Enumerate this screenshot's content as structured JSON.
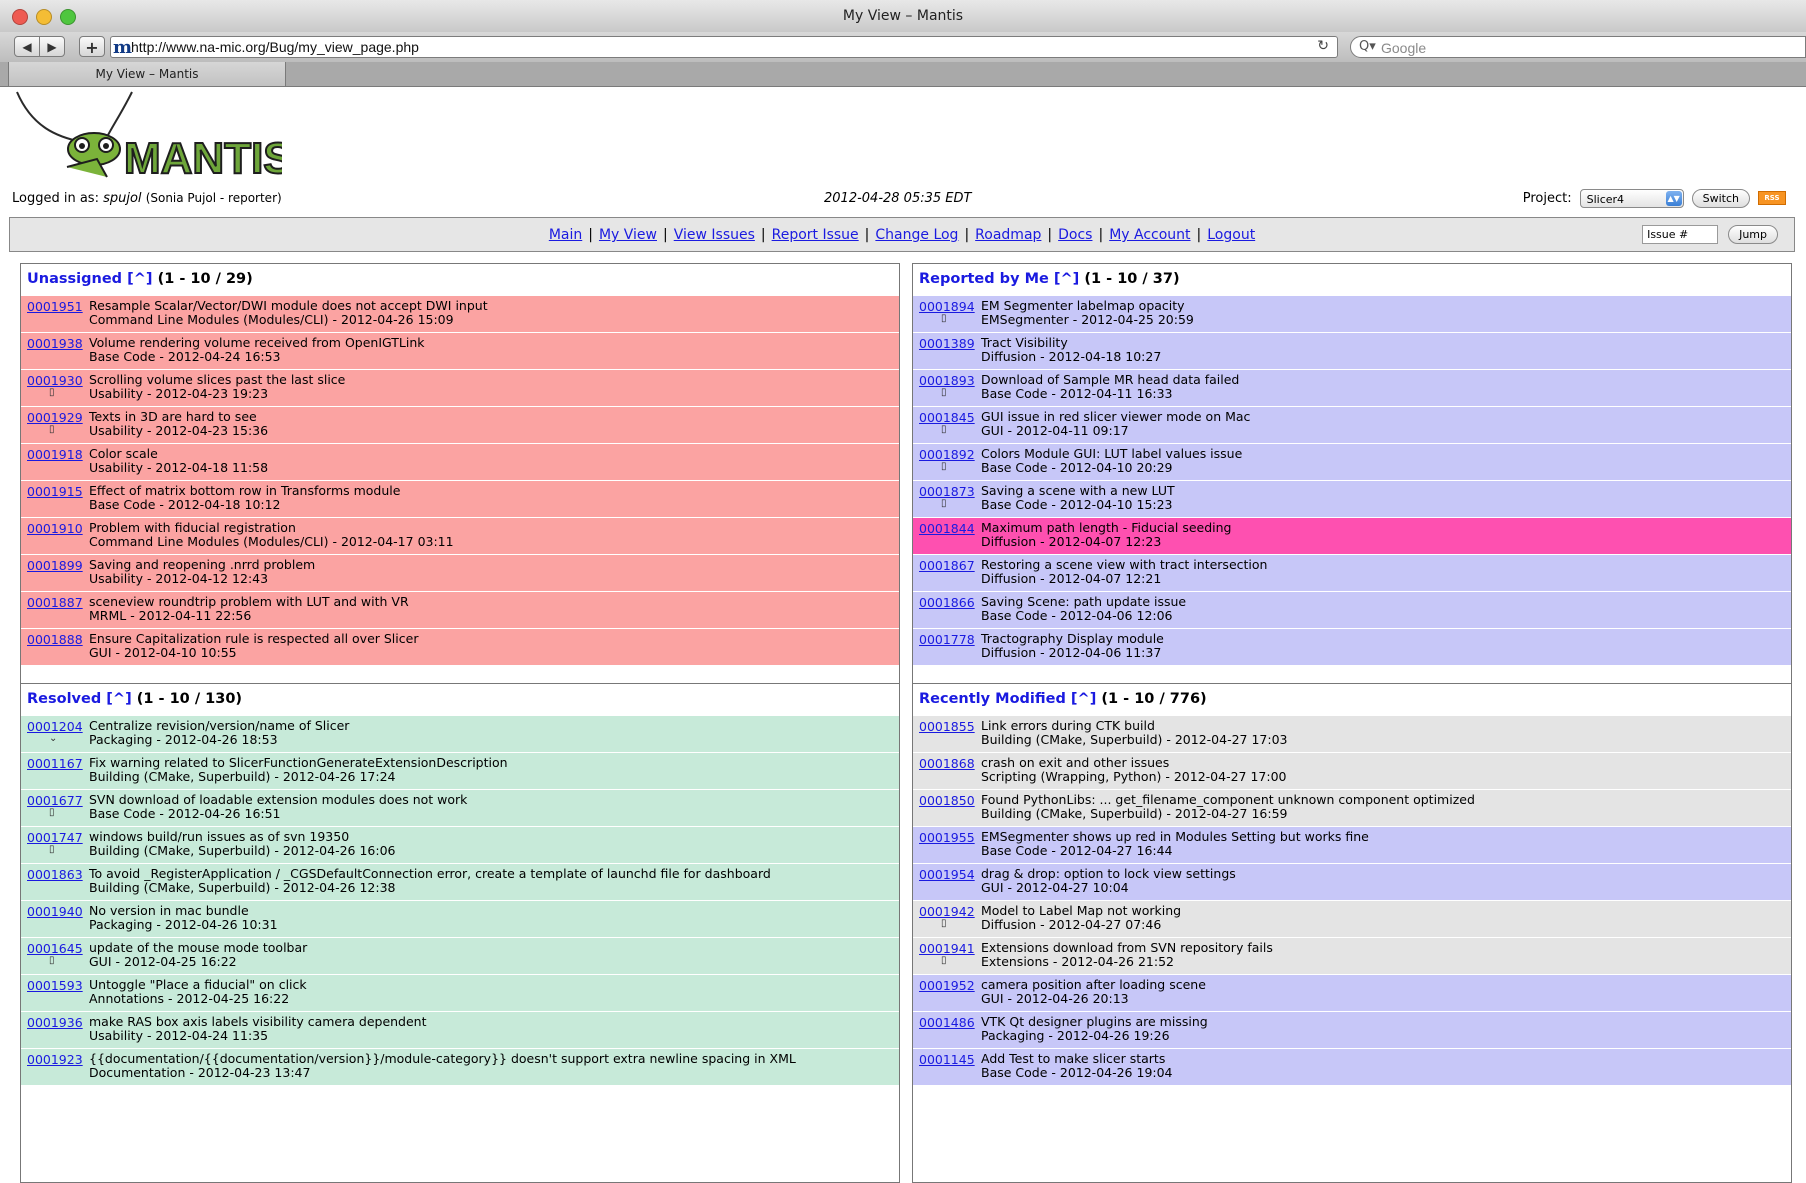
{
  "browser": {
    "window_title": "My View – Mantis",
    "url": "http://www.na-mic.org/Bug/my_view_page.php",
    "search_placeholder": "Google",
    "tab_label": "My View – Mantis",
    "favicon": "m"
  },
  "header": {
    "logo_text": "MANTIS",
    "logged_in_label": "Logged in as: ",
    "username": "spujol",
    "role": "(Sonia Pujol - reporter)",
    "datetime": "2012-04-28 05:35 EDT",
    "project_label": "Project:",
    "project_value": "Slicer4",
    "switch_label": "Switch",
    "rss_label": "RSS"
  },
  "menu": {
    "items": [
      {
        "label": "Main"
      },
      {
        "label": "My View"
      },
      {
        "label": "View Issues"
      },
      {
        "label": "Report Issue"
      },
      {
        "label": "Change Log"
      },
      {
        "label": "Roadmap"
      },
      {
        "label": "Docs"
      },
      {
        "label": "My Account"
      },
      {
        "label": "Logout"
      }
    ],
    "issue_placeholder": "Issue #",
    "jump_label": "Jump"
  },
  "boxes": {
    "unassigned": {
      "title": "Unassigned",
      "caret": "[^]",
      "range": "(1 - 10 / 29)",
      "rows": [
        {
          "id": "0001951",
          "title": "Resample Scalar/Vector/DWI module does not accept DWI input",
          "meta": "Command Line Modules (Modules/CLI) - 2012-04-26 15:09",
          "attachment": false,
          "color": "red"
        },
        {
          "id": "0001938",
          "title": "Volume rendering volume received from OpenIGTLink",
          "meta": "Base Code - 2012-04-24 16:53",
          "attachment": false,
          "color": "red"
        },
        {
          "id": "0001930",
          "title": "Scrolling volume slices past the last slice",
          "meta": "Usability - 2012-04-23 19:23",
          "attachment": true,
          "color": "red"
        },
        {
          "id": "0001929",
          "title": "Texts in 3D are hard to see",
          "meta": "Usability - 2012-04-23 15:36",
          "attachment": true,
          "color": "red"
        },
        {
          "id": "0001918",
          "title": "Color scale",
          "meta": "Usability - 2012-04-18 11:58",
          "attachment": false,
          "color": "red"
        },
        {
          "id": "0001915",
          "title": "Effect of matrix bottom row in Transforms module",
          "meta": "Base Code - 2012-04-18 10:12",
          "attachment": false,
          "color": "red"
        },
        {
          "id": "0001910",
          "title": "Problem with fiducial registration",
          "meta": "Command Line Modules (Modules/CLI) - 2012-04-17 03:11",
          "attachment": false,
          "color": "red"
        },
        {
          "id": "0001899",
          "title": "Saving and reopening .nrrd problem",
          "meta": "Usability - 2012-04-12 12:43",
          "attachment": false,
          "color": "red"
        },
        {
          "id": "0001887",
          "title": "sceneview roundtrip problem with LUT and with VR",
          "meta": "MRML - 2012-04-11 22:56",
          "attachment": false,
          "color": "red"
        },
        {
          "id": "0001888",
          "title": "Ensure Capitalization rule is respected all over Slicer",
          "meta": "GUI - 2012-04-10 10:55",
          "attachment": false,
          "color": "red"
        }
      ]
    },
    "reported_by_me": {
      "title": "Reported by Me",
      "caret": "[^]",
      "range": "(1 - 10 / 37)",
      "rows": [
        {
          "id": "0001894",
          "title": "EM Segmenter labelmap opacity",
          "meta": "EMSegmenter - 2012-04-25 20:59",
          "attachment": true,
          "color": "blue"
        },
        {
          "id": "0001389",
          "title": "Tract Visibility",
          "meta": "Diffusion - 2012-04-18 10:27",
          "attachment": false,
          "color": "blue"
        },
        {
          "id": "0001893",
          "title": "Download of Sample MR head data failed",
          "meta": "Base Code - 2012-04-11 16:33",
          "attachment": true,
          "color": "blue"
        },
        {
          "id": "0001845",
          "title": "GUI issue in red slicer viewer mode on Mac",
          "meta": "GUI - 2012-04-11 09:17",
          "attachment": true,
          "color": "blue"
        },
        {
          "id": "0001892",
          "title": "Colors Module GUI: LUT label values issue",
          "meta": "Base Code - 2012-04-10 20:29",
          "attachment": true,
          "color": "blue"
        },
        {
          "id": "0001873",
          "title": "Saving a scene with a new LUT",
          "meta": "Base Code - 2012-04-10 15:23",
          "attachment": true,
          "color": "blue"
        },
        {
          "id": "0001844",
          "title": "Maximum path length - Fiducial seeding",
          "meta": "Diffusion - 2012-04-07 12:23",
          "attachment": false,
          "color": "pink"
        },
        {
          "id": "0001867",
          "title": "Restoring a scene view with tract intersection",
          "meta": "Diffusion - 2012-04-07 12:21",
          "attachment": false,
          "color": "blue"
        },
        {
          "id": "0001866",
          "title": "Saving Scene: path update issue",
          "meta": "Base Code - 2012-04-06 12:06",
          "attachment": false,
          "color": "blue"
        },
        {
          "id": "0001778",
          "title": "Tractography Display module",
          "meta": "Diffusion - 2012-04-06 11:37",
          "attachment": false,
          "color": "blue"
        }
      ]
    },
    "resolved": {
      "title": "Resolved",
      "caret": "[^]",
      "range": "(1 - 10 / 130)",
      "rows": [
        {
          "id": "0001204",
          "title": "Centralize revision/version/name of Slicer",
          "meta": "Packaging - 2012-04-26 18:53",
          "attachment": false,
          "chevron": true,
          "color": "green"
        },
        {
          "id": "0001167",
          "title": "Fix warning related to SlicerFunctionGenerateExtensionDescription",
          "meta": "Building (CMake, Superbuild) - 2012-04-26 17:24",
          "attachment": false,
          "color": "green"
        },
        {
          "id": "0001677",
          "title": "SVN download of loadable extension modules does not work",
          "meta": "Base Code - 2012-04-26 16:51",
          "attachment": true,
          "color": "green"
        },
        {
          "id": "0001747",
          "title": "windows build/run issues as of svn 19350",
          "meta": "Building (CMake, Superbuild) - 2012-04-26 16:06",
          "attachment": true,
          "color": "green"
        },
        {
          "id": "0001863",
          "title": "To avoid _RegisterApplication / _CGSDefaultConnection error, create a template of launchd file for dashboard",
          "meta": "Building (CMake, Superbuild) - 2012-04-26 12:38",
          "attachment": false,
          "color": "green"
        },
        {
          "id": "0001940",
          "title": "No version in mac bundle",
          "meta": "Packaging - 2012-04-26 10:31",
          "attachment": false,
          "color": "green"
        },
        {
          "id": "0001645",
          "title": "update of the mouse mode toolbar",
          "meta": "GUI - 2012-04-25 16:22",
          "attachment": true,
          "color": "green"
        },
        {
          "id": "0001593",
          "title": "Untoggle \"Place a fiducial\" on click",
          "meta": "Annotations - 2012-04-25 16:22",
          "attachment": false,
          "color": "green"
        },
        {
          "id": "0001936",
          "title": "make RAS box axis labels visibility camera dependent",
          "meta": "Usability - 2012-04-24 11:35",
          "attachment": false,
          "color": "green"
        },
        {
          "id": "0001923",
          "title": "{{documentation/{{documentation/version}}/module-category}} doesn't support extra newline spacing in XML",
          "meta": "Documentation - 2012-04-23 13:47",
          "attachment": false,
          "color": "green"
        }
      ]
    },
    "recently_modified": {
      "title": "Recently Modified",
      "caret": "[^]",
      "range": "(1 - 10 / 776)",
      "rows": [
        {
          "id": "0001855",
          "title": "Link errors during CTK build",
          "meta": "Building (CMake, Superbuild) - 2012-04-27 17:03",
          "attachment": false,
          "color": "gray"
        },
        {
          "id": "0001868",
          "title": "crash on exit and other issues",
          "meta": "Scripting (Wrapping, Python) - 2012-04-27 17:00",
          "attachment": false,
          "color": "gray"
        },
        {
          "id": "0001850",
          "title": "Found PythonLibs: ... get_filename_component unknown component optimized",
          "meta": "Building (CMake, Superbuild) - 2012-04-27 16:59",
          "attachment": false,
          "color": "gray"
        },
        {
          "id": "0001955",
          "title": "EMSegmenter shows up red in Modules Setting but works fine",
          "meta": "Base Code - 2012-04-27 16:44",
          "attachment": false,
          "color": "blue"
        },
        {
          "id": "0001954",
          "title": "drag & drop: option to lock view settings",
          "meta": "GUI - 2012-04-27 10:04",
          "attachment": false,
          "color": "blue"
        },
        {
          "id": "0001942",
          "title": "Model to Label Map not working",
          "meta": "Diffusion - 2012-04-27 07:46",
          "attachment": true,
          "color": "gray"
        },
        {
          "id": "0001941",
          "title": "Extensions download from SVN repository fails",
          "meta": "Extensions - 2012-04-26 21:52",
          "attachment": true,
          "color": "gray"
        },
        {
          "id": "0001952",
          "title": "camera position after loading scene",
          "meta": "GUI - 2012-04-26 20:13",
          "attachment": false,
          "color": "blue"
        },
        {
          "id": "0001486",
          "title": "VTK Qt designer plugins are missing",
          "meta": "Packaging - 2012-04-26 19:26",
          "attachment": false,
          "color": "blue"
        },
        {
          "id": "0001145",
          "title": "Add Test to make slicer starts",
          "meta": "Base Code - 2012-04-26 19:04",
          "attachment": false,
          "color": "blue"
        }
      ]
    }
  },
  "colors": {
    "red": "#fba3a2",
    "blue": "#c7c7f8",
    "pink": "#fe50b0",
    "green": "#c7ead9",
    "gray": "#e4e4e4",
    "link": "#1a1ae0"
  }
}
